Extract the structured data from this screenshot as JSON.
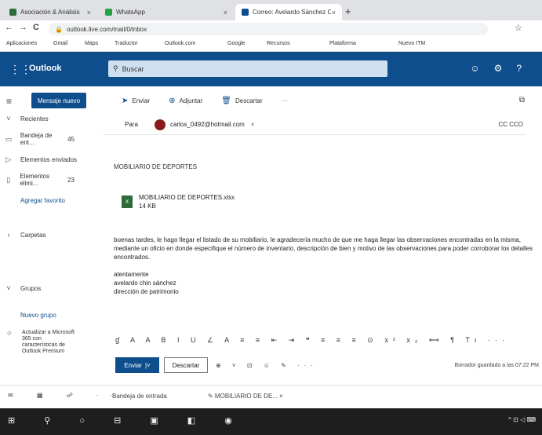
{
  "browser": {
    "tabs": [
      {
        "label": "Asociación & Análisis",
        "icon_color": "#2e6b3a",
        "close": "×"
      },
      {
        "label": "WhatsApp",
        "icon_color": "#25a244",
        "close": "×"
      },
      {
        "label": "Correo: Avelardo Sánchez Castillo",
        "icon_color": "#0f4e8c",
        "close": "×"
      }
    ],
    "new_tab": "+",
    "nav": {
      "back": "←",
      "forward": "→",
      "reload": "C"
    },
    "url": "outlook.live.com/mail/0/inbox",
    "bookmarks": [
      "Aplicaciones",
      "Gmail",
      "Maps",
      "Traductor",
      "Outlook.com",
      "Google",
      "Recursos",
      "Plataforma",
      "Nuevo ITM"
    ],
    "star": "☆"
  },
  "outlook": {
    "brand": "Outlook",
    "search_placeholder": "Buscar"
  },
  "leftnav": {
    "new_message": "Mensaje nuevo",
    "items": [
      {
        "icon": "˅",
        "label": "Recientes",
        "count": ""
      },
      {
        "icon": "▭",
        "label": "Bandeja de ent...",
        "count": "45"
      },
      {
        "icon": "▷",
        "label": "Elementos enviados",
        "count": ""
      },
      {
        "icon": "▯",
        "label": "Elementos elimi...",
        "count": "23"
      },
      {
        "icon": "",
        "label": "Agregar favorito",
        "count": ""
      },
      {
        "icon": "›",
        "label": "Carpetas",
        "count": ""
      },
      {
        "icon": "˅",
        "label": "Grupos",
        "count": ""
      },
      {
        "icon": "",
        "label": "Nuevo grupo",
        "count": ""
      }
    ],
    "upgrade": "Actualizar a Microsoft 365 con características de Outlook Premium"
  },
  "compose": {
    "commands": [
      {
        "icon": "➤",
        "label": "Enviar"
      },
      {
        "icon": "⊕",
        "label": "Adjuntar"
      },
      {
        "icon": "🗑",
        "label": "Descartar"
      },
      {
        "icon": "",
        "label": "···"
      }
    ],
    "to_label": "Para",
    "recipient": "carlos_0492@hotmail.com",
    "cc_label": "CC  CCO",
    "subject": "MOBILIARIO DE DEPORTES",
    "attachment": {
      "name": "MOBILIARIO DE DEPORTES.xlsx",
      "size": "14 KB",
      "icon": "X"
    },
    "body": "buenas tardes, le hago llegar el listado de su mobiliario, le agradecería mucho de que me haga llegar las observaciones encontradas en la misma, mediante un oficio en donde especifique el número de inventario, descripción de bien y motivo de las observaciones para poder corroborar los detalles encontrados.",
    "signature": [
      "atentamente",
      "avelardo chin sánchez",
      "dirección de patrimonio"
    ],
    "format_tools": "ɠ A A B I U ∠ A ≡ ≡ ⇤ ⇥ ❝ ≡ ≡ ≡ ⊙ x² x₂ ⟷ ¶ Tı ···",
    "send": "Enviar",
    "send_arrow": "|˅",
    "discard": "Descartar",
    "send_tools": "⊕ ˅ ⊡ ☺ ✎ ···",
    "draft_status": "Borrador guardado a las 07:22 PM"
  },
  "bottom": {
    "icons": "✉ ▦ ☍ ···",
    "tab1": "Bandeja de entrada",
    "tab2": "✎ MOBILIARIO DE DE...  ×"
  },
  "taskbar": {
    "icons": "⊞ ⚲ ○ ⊟ ▣ ◧ ◉",
    "tray": "^ ⊡ ◁ ⌨"
  }
}
